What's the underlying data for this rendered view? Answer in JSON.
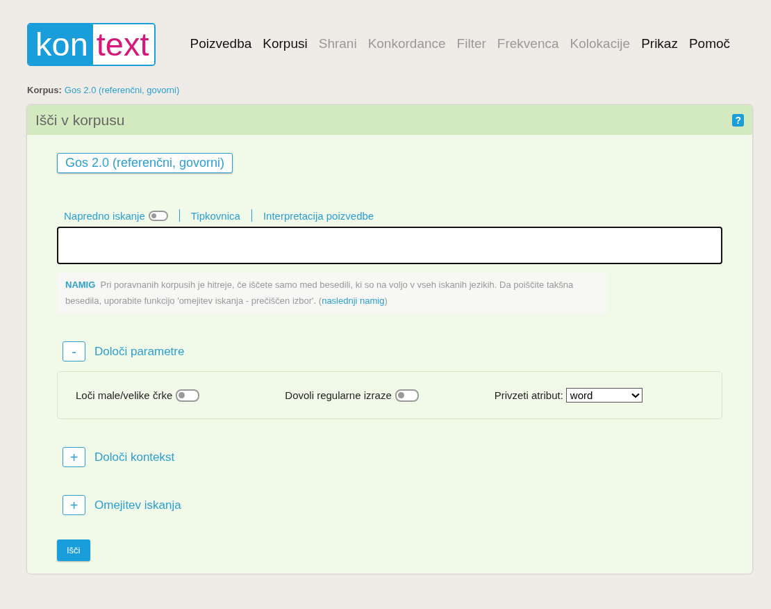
{
  "logo": {
    "part_1": "kon",
    "part_2": "text"
  },
  "nav": [
    {
      "label": "Poizvedba",
      "disabled": false
    },
    {
      "label": "Korpusi",
      "disabled": false
    },
    {
      "label": "Shrani",
      "disabled": true
    },
    {
      "label": "Konkordance",
      "disabled": true
    },
    {
      "label": "Filter",
      "disabled": true
    },
    {
      "label": "Frekvenca",
      "disabled": true
    },
    {
      "label": "Kolokacije",
      "disabled": true
    },
    {
      "label": "Prikaz",
      "disabled": false
    },
    {
      "label": "Pomoč",
      "disabled": false
    }
  ],
  "corpus_line": {
    "label": "Korpus:",
    "value": "Gos 2.0 (referenčni, govorni)"
  },
  "panel": {
    "title": "Išči v korpusu",
    "help": "?",
    "corpus_button": "Gos 2.0 (referenčni, govorni)",
    "query_links": [
      {
        "label": "Napredno iskanje",
        "kind": "toggle",
        "on": false
      },
      {
        "label": "Tipkovnica",
        "kind": "link"
      },
      {
        "label": "Interpretacija poizvedbe",
        "kind": "link"
      }
    ],
    "hint": {
      "label": "NAMIG",
      "text": "Pri poravnanih korpusih je hitreje, če iščete samo med besedili, ki so na voljo v vseh iskanih jezikih. Da poiščite takšna besedila, uporabite funkcijo 'omejitev iskanja - prečiščen izbor'.   (",
      "link": "naslednji namig",
      "after": ")"
    },
    "sections": [
      {
        "label": "Določi parametre",
        "sign": "-",
        "options": [
          {
            "kind": "toggle",
            "label": "Loči male/velike črke",
            "on": false
          },
          {
            "kind": "toggle",
            "label": "Dovoli regularne izraze",
            "on": false
          },
          {
            "kind": "select",
            "label": "Privzeti atribut:",
            "value": "word"
          }
        ]
      },
      {
        "label": "Določi kontekst",
        "sign": "+"
      },
      {
        "label": "Omejitev iskanja",
        "sign": "+"
      }
    ],
    "search_button": "Išči"
  }
}
